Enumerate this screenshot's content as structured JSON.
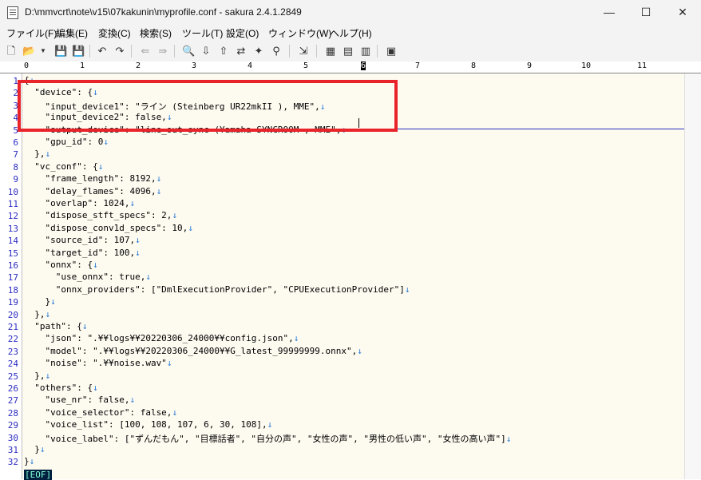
{
  "window": {
    "title": "D:\\mmvcrt\\note\\v15\\07kakunin\\myprofile.conf - sakura 2.4.1.2849",
    "minimize": "—",
    "maximize": "☐",
    "close": "✕"
  },
  "menu": [
    "ファイル(F)",
    "編集(E)",
    "変換(C)",
    "検索(S)",
    "ツール(T)",
    "設定(O)",
    "ウィンドウ(W)",
    "ヘルプ(H)"
  ],
  "ruler": [
    "0",
    "1",
    "2",
    "3",
    "4",
    "5",
    "6",
    "7",
    "8",
    "9",
    "10",
    "11"
  ],
  "lines": [
    {
      "n": "1",
      "t": "{"
    },
    {
      "n": "2",
      "t": "  \"device\": {"
    },
    {
      "n": "3",
      "t": "    \"input_device1\": \"ライン (Steinberg UR22mkII ), MME\","
    },
    {
      "n": "4",
      "t": "    \"input_device2\": false,"
    },
    {
      "n": "5",
      "t": "    \"output_device\": \"line_out_sync (Yamaha SYNCROOM , MME\","
    },
    {
      "n": "6",
      "t": "    \"gpu_id\": 0"
    },
    {
      "n": "7",
      "t": "  },"
    },
    {
      "n": "8",
      "t": "  \"vc_conf\": {"
    },
    {
      "n": "9",
      "t": "    \"frame_length\": 8192,"
    },
    {
      "n": "10",
      "t": "    \"delay_flames\": 4096,"
    },
    {
      "n": "11",
      "t": "    \"overlap\": 1024,"
    },
    {
      "n": "12",
      "t": "    \"dispose_stft_specs\": 2,"
    },
    {
      "n": "13",
      "t": "    \"dispose_conv1d_specs\": 10,"
    },
    {
      "n": "14",
      "t": "    \"source_id\": 107,"
    },
    {
      "n": "15",
      "t": "    \"target_id\": 100,"
    },
    {
      "n": "16",
      "t": "    \"onnx\": {"
    },
    {
      "n": "17",
      "t": "      \"use_onnx\": true,"
    },
    {
      "n": "18",
      "t": "      \"onnx_providers\": [\"DmlExecutionProvider\", \"CPUExecutionProvider\"]"
    },
    {
      "n": "19",
      "t": "    }"
    },
    {
      "n": "20",
      "t": "  },"
    },
    {
      "n": "21",
      "t": "  \"path\": {"
    },
    {
      "n": "22",
      "t": "    \"json\": \".¥¥logs¥¥20220306_24000¥¥config.json\","
    },
    {
      "n": "23",
      "t": "    \"model\": \".¥¥logs¥¥20220306_24000¥¥G_latest_99999999.onnx\","
    },
    {
      "n": "24",
      "t": "    \"noise\": \".¥¥noise.wav\""
    },
    {
      "n": "25",
      "t": "  },"
    },
    {
      "n": "26",
      "t": "  \"others\": {"
    },
    {
      "n": "27",
      "t": "    \"use_nr\": false,"
    },
    {
      "n": "28",
      "t": "    \"voice_selector\": false,"
    },
    {
      "n": "29",
      "t": "    \"voice_list\": [100, 108, 107, 6, 30, 108],"
    },
    {
      "n": "30",
      "t": "    \"voice_label\": [\"ずんだもん\", \"目標話者\", \"自分の声\", \"女性の声\", \"男性の低い声\", \"女性の高い声\"]"
    },
    {
      "n": "31",
      "t": "  }"
    },
    {
      "n": "32",
      "t": "}"
    }
  ],
  "eol_mark": "↓",
  "eof_mark": "[EOF]",
  "colors": {
    "highlight": "#e8232a",
    "line_number": "#2c2cc2",
    "eol": "#2a7bd4",
    "background": "#fdfaf0"
  }
}
